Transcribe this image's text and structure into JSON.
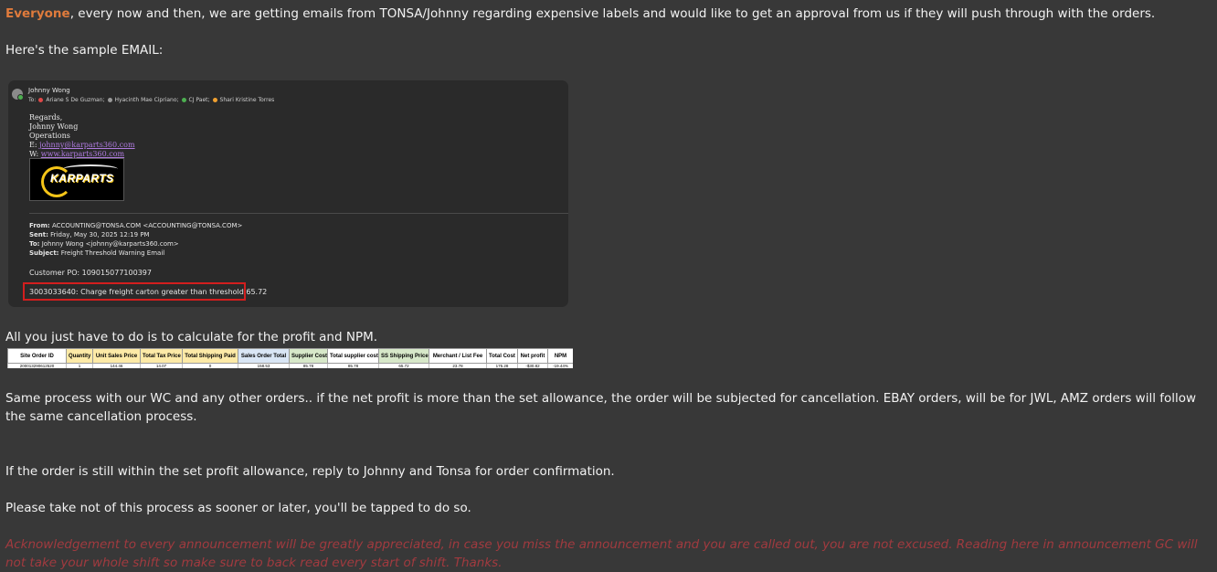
{
  "message": {
    "mention": "Everyone",
    "line1_rest": ", every now and then, we are getting emails from TONSA/Johnny regarding expensive labels and would like to get an approval from us if they will push through with the orders.",
    "line2": "Here's the sample EMAIL:",
    "line3": "All you just have to do is to calculate for the profit and NPM.",
    "line4": "Same process with our WC and any other orders.. if the net profit is more than the set allowance, the order will be subjected for cancellation. EBAY orders, will be for JWL, AMZ orders will follow the same cancellation process.",
    "line5": "If the order is still within the set profit allowance, reply to Johnny and Tonsa for order confirmation.",
    "line6": "Please take not of this process as sooner or later, you'll be tapped to do so.",
    "acknowledgement": "Acknowledgement to every announcement will be greatly appreciated, in case you miss the announcement and you are called out, you are not excused. Reading here in announcement GC will not take your whole shift so make sure to back read every start of shift. Thanks."
  },
  "email_image": {
    "sender": "Johnny Wong",
    "to_label": "To:",
    "recipients": [
      {
        "name": "Ariane S De Guzman;",
        "color": "#e04848"
      },
      {
        "name": "Hyacinth Mae Cipriano;",
        "color": "#9a9a9a"
      },
      {
        "name": "CJ Paet;",
        "color": "#4caf50"
      },
      {
        "name": "Shari Kristine Torres",
        "color": "#f0a030"
      }
    ],
    "signature": {
      "regards": "Regards,",
      "name": "Johnny Wong",
      "dept": "Operations",
      "email_label": "E:",
      "email": "johnny@karparts360.com",
      "web_label": "W:",
      "web": "www.karparts360.com"
    },
    "logo_text": "KARPARTS",
    "forwarded": {
      "from_label": "From:",
      "from": "ACCOUNTING@TONSA.COM <ACCOUNTING@TONSA.COM>",
      "sent_label": "Sent:",
      "sent": "Friday, May 30, 2025 12:19 PM",
      "to_label": "To:",
      "to": "Johnny Wong <johnny@karparts360.com>",
      "subject_label": "Subject:",
      "subject": "Freight Threshold Warning Email"
    },
    "customer_po": "Customer PO: 109015077100397",
    "charge_line": "3003033640: Charge freight carton greater than threshold 65.72"
  },
  "table_image": {
    "headers": [
      {
        "label": "Site Order ID",
        "style": "h-white"
      },
      {
        "label": "Quantity",
        "style": "h-yellow"
      },
      {
        "label": "Unit Sales Price",
        "style": "h-yellow"
      },
      {
        "label": "Total Tax Price",
        "style": "h-yellow"
      },
      {
        "label": "Total Shipping Paid",
        "style": "h-yellow"
      },
      {
        "label": "Sales Order Total",
        "style": "h-blue"
      },
      {
        "label": "Supplier Cost",
        "style": "h-green"
      },
      {
        "label": "Total supplier cost",
        "style": "h-white"
      },
      {
        "label": "SS Shipping Price",
        "style": "h-green"
      },
      {
        "label": "Merchant / List Fee",
        "style": "h-white"
      },
      {
        "label": "Total Cost",
        "style": "h-white"
      },
      {
        "label": "Net profit",
        "style": "h-white"
      },
      {
        "label": "NPM",
        "style": "h-white"
      }
    ],
    "row": [
      "200013290612520",
      "1",
      "144.46",
      "14.07",
      "0",
      "158.53",
      "85.78",
      "85.78",
      "65.72",
      "23.78",
      "175.28",
      "-$30.82",
      "-19.44%"
    ]
  }
}
